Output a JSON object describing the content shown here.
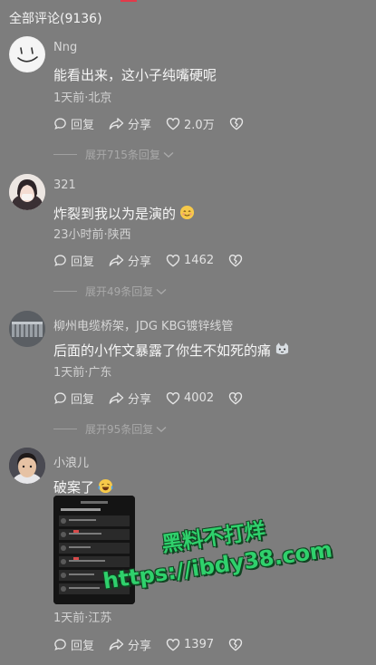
{
  "header": {
    "title": "全部评论(9136)"
  },
  "actions": {
    "reply": "回复",
    "share": "分享"
  },
  "comments": [
    {
      "user": "Nng",
      "text": "能看出来，这小子纯嘴硬呢",
      "meta": "1天前·北京",
      "likes": "2.0万",
      "expand": "展开715条回复"
    },
    {
      "user": "321",
      "text": "炸裂到我以为是演的",
      "meta": "23小时前·陕西",
      "likes": "1462",
      "expand": "展开49条回复"
    },
    {
      "user": "柳州电缆桥架，JDG KBG镀锌线管",
      "text": "后面的小作文暴露了你生不如死的痛",
      "meta": "1天前·广东",
      "likes": "4002",
      "expand": "展开95条回复"
    },
    {
      "user": "小浪儿",
      "text": "破案了",
      "meta": "1天前·江苏",
      "likes": "1397"
    }
  ],
  "watermark": {
    "line1": "黑料不打烊",
    "line2": "https://ibdy38.com"
  },
  "colors": {
    "background": "#7d7d7d",
    "accent": "#e23a4a",
    "watermark": "#2fd16c"
  }
}
